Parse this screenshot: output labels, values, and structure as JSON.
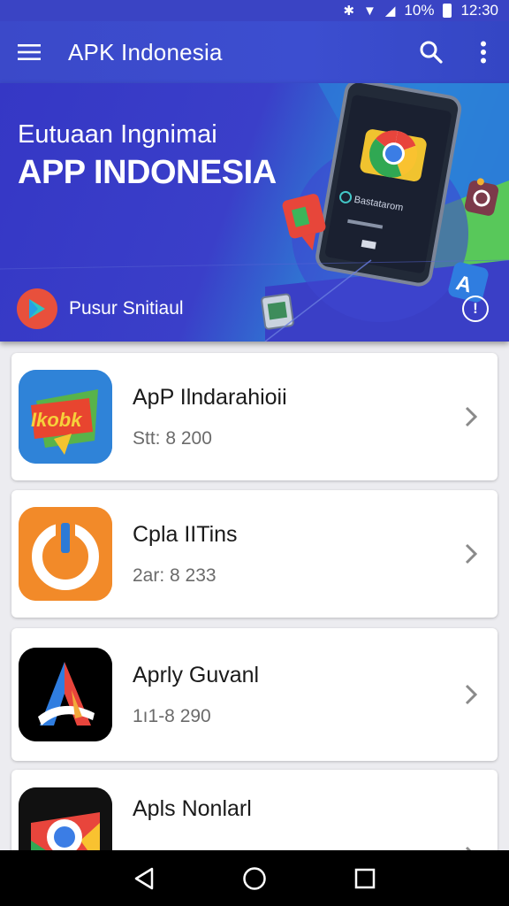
{
  "status_bar": {
    "battery": "10%",
    "time": "12:30"
  },
  "app_bar": {
    "title": "APK Indonesia",
    "color": "#3b49c9"
  },
  "banner": {
    "line1": "Eutuaan Ingnimai",
    "line2": "APP INDONESIA",
    "subtitle": "Pusur Snitiaul",
    "phone_caption": "Bastatarom"
  },
  "apps": [
    {
      "name": "ApP Ilndarahioii",
      "meta": "Stt: 8 200",
      "icon": "kite-app-icon",
      "icon_text": "Ikobk"
    },
    {
      "name": "Cpla IITins",
      "meta": "2ar: 8 233",
      "icon": "power-app-icon"
    },
    {
      "name": "Aprly Guvanl",
      "meta": "1ı1-8 290",
      "icon": "letter-a-app-icon"
    },
    {
      "name": "Apls Nonlarl",
      "meta": "",
      "icon": "chrome-app-icon"
    }
  ],
  "colors": {
    "accent": "#3b49c9",
    "play": "#e8503c",
    "nav": "#000000"
  }
}
